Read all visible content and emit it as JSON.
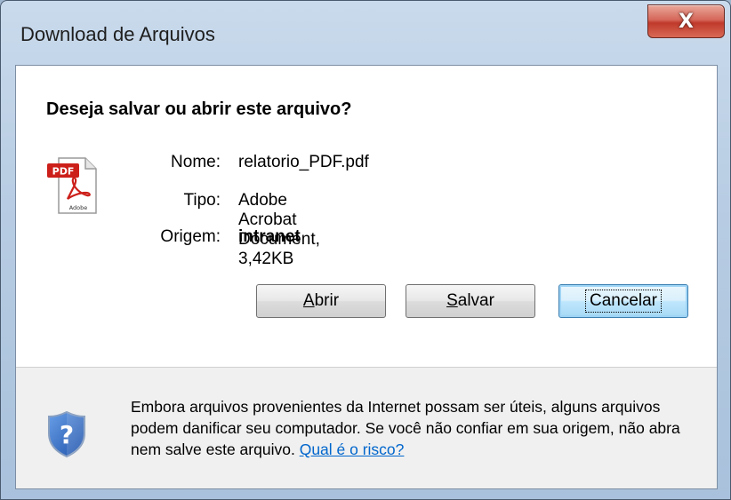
{
  "window": {
    "title": "Download de Arquivos",
    "close_label": "X"
  },
  "dialog": {
    "question": "Deseja salvar ou abrir este arquivo?",
    "file_icon": "pdf-file-icon",
    "fields": [
      {
        "label": "Nome:",
        "value": "relatorio_PDF.pdf"
      },
      {
        "label": "Tipo:",
        "value": "Adobe Acrobat Document, 3,42KB"
      },
      {
        "label": "Origem:",
        "value": "intranet"
      }
    ],
    "buttons": {
      "open": {
        "mnemonic": "A",
        "rest": "brir"
      },
      "save": {
        "mnemonic": "S",
        "rest": "alvar"
      },
      "cancel": "Cancelar"
    }
  },
  "footer": {
    "icon": "shield-question-icon",
    "warning_text": "Embora arquivos provenientes da Internet possam ser úteis, alguns arquivos podem danificar seu computador. Se você não confiar em sua origem, não abra nem salve este arquivo.",
    "risk_link": "Qual é o risco?"
  },
  "colors": {
    "link": "#0066cc",
    "close_button": "#c0392b",
    "footer_bg": "#f0f0f0"
  }
}
